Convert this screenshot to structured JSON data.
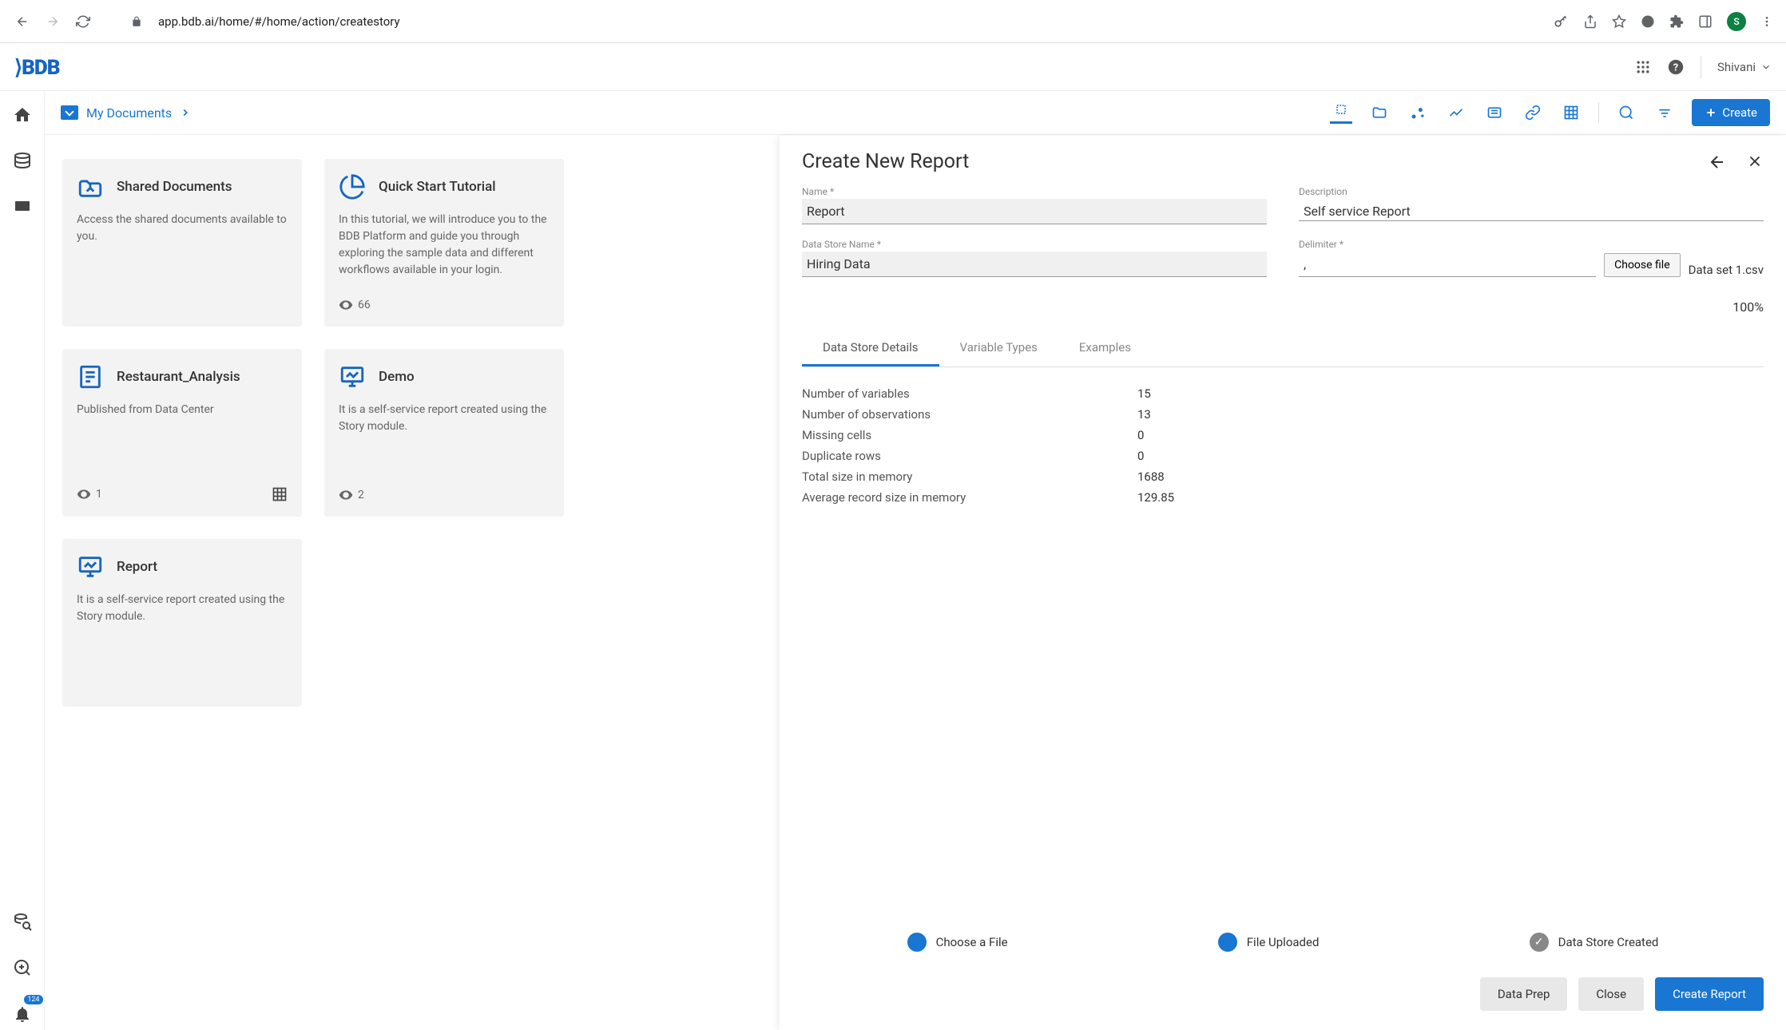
{
  "browser": {
    "url": "app.bdb.ai/home/#/home/action/createstory",
    "avatar_letter": "S"
  },
  "header": {
    "logo": "BDB",
    "user": "Shivani"
  },
  "sidebar": {
    "notif_count": "124"
  },
  "topbar": {
    "breadcrumb": "My Documents",
    "create_label": "Create"
  },
  "cards": [
    {
      "title": "Shared Documents",
      "desc": "Access the shared documents available to you.",
      "views": ""
    },
    {
      "title": "Quick Start Tutorial",
      "desc": "In this tutorial, we will introduce you to the BDB Platform and guide you through exploring the sample data and different workflows available in your login.",
      "views": "66"
    },
    {
      "title": "Restaurant_Analysis",
      "desc": "Published from Data Center",
      "views": "1"
    },
    {
      "title": "Demo",
      "desc": "It is a self-service report created using the Story module.",
      "views": "2"
    },
    {
      "title": "Report",
      "desc": "It is a self-service report created using the Story module.",
      "views": ""
    }
  ],
  "panel": {
    "title": "Create New Report",
    "labels": {
      "name": "Name *",
      "description": "Description",
      "datastore": "Data Store Name *",
      "delimiter": "Delimiter *",
      "choose_file": "Choose file"
    },
    "values": {
      "name": "Report",
      "description": "Self service Report",
      "datastore": "Hiring Data",
      "delimiter": ",",
      "filename": "Data set 1.csv",
      "progress": "100%"
    },
    "tabs": [
      "Data Store Details",
      "Variable Types",
      "Examples"
    ],
    "details": [
      {
        "label": "Number of variables",
        "value": "15"
      },
      {
        "label": "Number of observations",
        "value": "13"
      },
      {
        "label": "Missing cells",
        "value": "0"
      },
      {
        "label": "Duplicate rows",
        "value": "0"
      },
      {
        "label": "Total size in memory",
        "value": "1688"
      },
      {
        "label": "Average record size in memory",
        "value": "129.85"
      }
    ],
    "steps": [
      "Choose a File",
      "File Uploaded",
      "Data Store Created"
    ],
    "actions": {
      "data_prep": "Data Prep",
      "close": "Close",
      "create": "Create Report"
    }
  }
}
